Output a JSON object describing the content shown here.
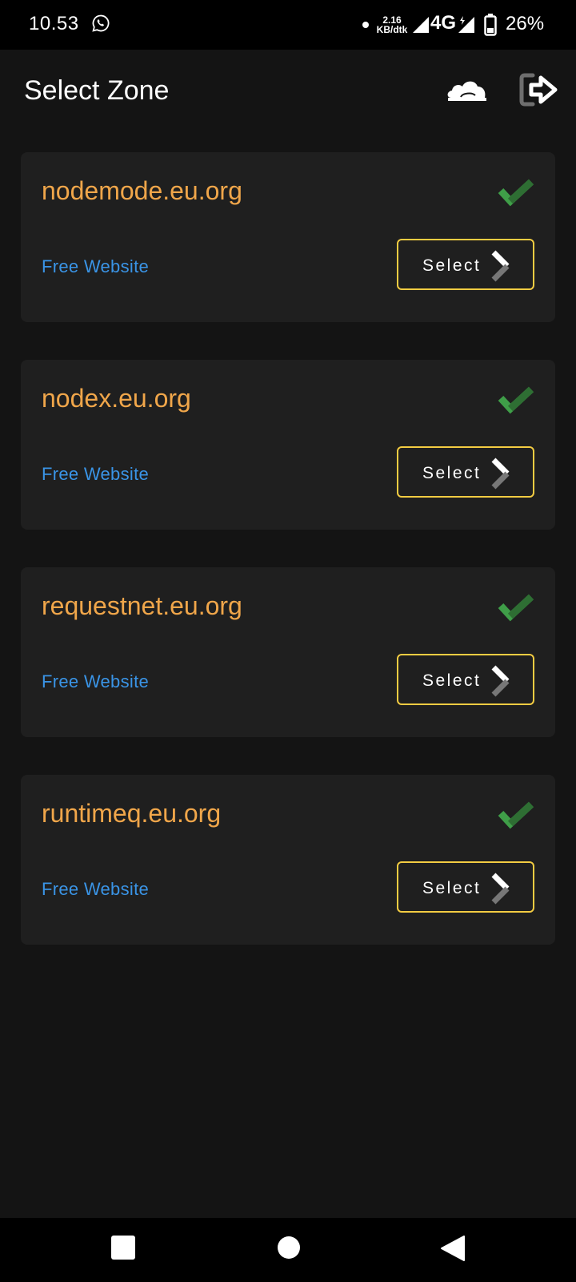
{
  "status_bar": {
    "time": "10.53",
    "net_speed_value": "2.16",
    "net_speed_unit": "KB/dtk",
    "network_type": "4G",
    "battery": "26%",
    "icons": [
      "whatsapp-icon",
      "signal-icon",
      "battery-icon"
    ]
  },
  "app_bar": {
    "title": "Select Zone",
    "actions": [
      "cloud-icon",
      "logout-icon"
    ]
  },
  "zones": [
    {
      "name": "nodemode.eu.org",
      "plan": "Free Website",
      "status": "active",
      "button": "Select"
    },
    {
      "name": "nodex.eu.org",
      "plan": "Free Website",
      "status": "active",
      "button": "Select"
    },
    {
      "name": "requestnet.eu.org",
      "plan": "Free Website",
      "status": "active",
      "button": "Select"
    },
    {
      "name": "runtimeq.eu.org",
      "plan": "Free Website",
      "status": "active",
      "button": "Select"
    }
  ],
  "nav_bar": {
    "buttons": [
      "recent-apps",
      "home",
      "back"
    ]
  },
  "colors": {
    "background": "#141414",
    "card": "#1f1f1f",
    "zone_name": "#f0a64a",
    "plan": "#3a94e6",
    "button_border": "#f3cc42",
    "check": "#3f9e48"
  }
}
